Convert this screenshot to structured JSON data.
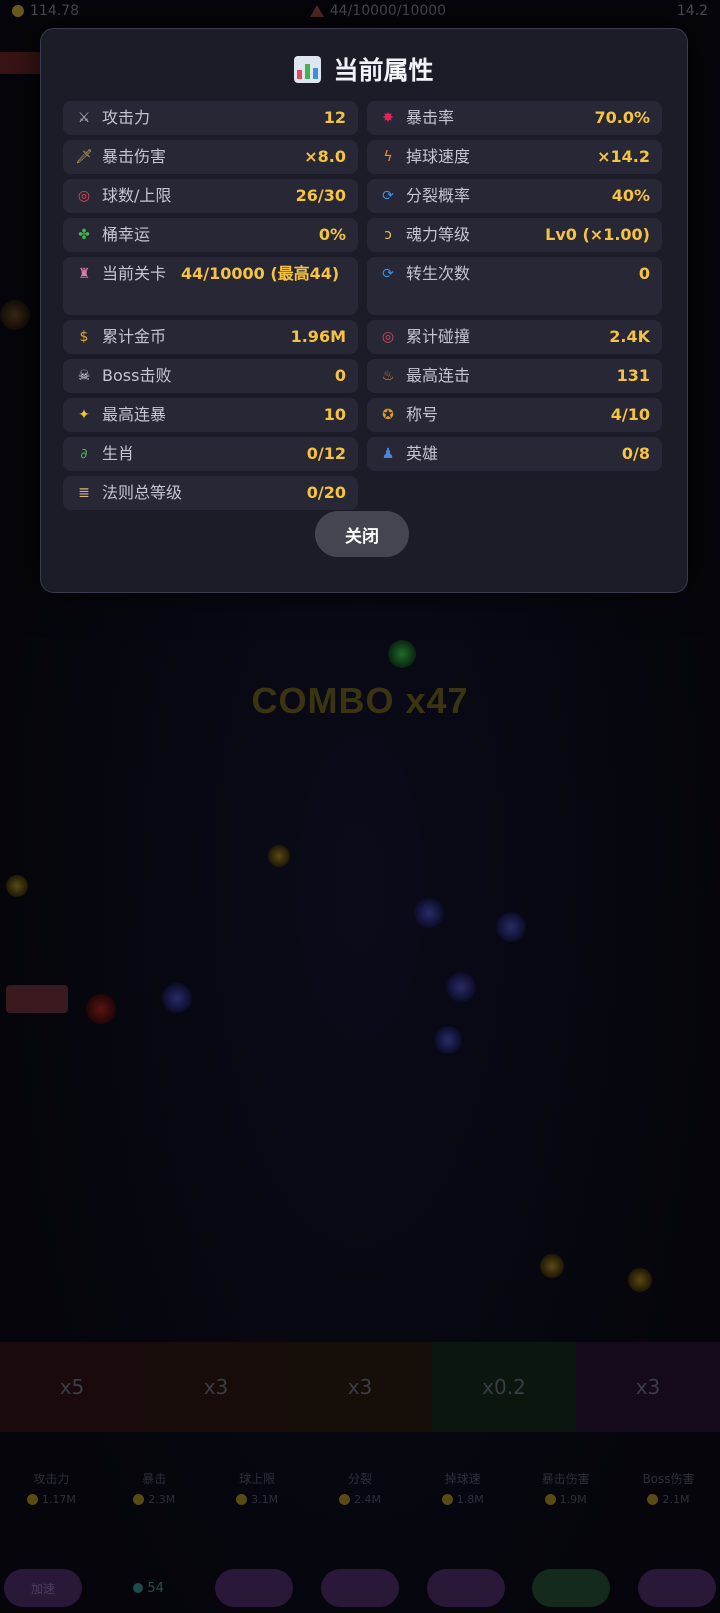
{
  "background": {
    "topbar": {
      "coins": "114.78",
      "level": "44/10000/10000",
      "right": "14.2"
    },
    "combo_text": "COMBO x47",
    "multipliers": [
      "x5",
      "x3",
      "x3",
      "x0.2",
      "x3"
    ],
    "upgrades": [
      {
        "name": "攻击力",
        "price": "1.17M"
      },
      {
        "name": "暴击",
        "price": "2.3M"
      },
      {
        "name": "球上限",
        "price": "3.1M"
      },
      {
        "name": "分裂",
        "price": "2.4M"
      },
      {
        "name": "掉球速",
        "price": "1.8M"
      },
      {
        "name": "暴击伤害",
        "price": "1.9M"
      },
      {
        "name": "Boss伤害",
        "price": "2.1M"
      }
    ],
    "nav": {
      "left": "加速",
      "count": "54"
    }
  },
  "modal": {
    "title": "当前属性",
    "close_label": "关闭",
    "stats": [
      {
        "icon": "crossed-swords-icon",
        "glyph": "⚔",
        "color": "#b9b9c8",
        "label": "攻击力",
        "value": "12"
      },
      {
        "icon": "explosion-icon",
        "glyph": "✸",
        "color": "#e0245e",
        "label": "暴击率",
        "value": "70.0%"
      },
      {
        "icon": "dagger-icon",
        "glyph": "🗡",
        "color": "#c9a24a",
        "label": "暴击伤害",
        "value": "×8.0"
      },
      {
        "icon": "lightning-icon",
        "glyph": "ϟ",
        "color": "#ff8a2a",
        "label": "掉球速度",
        "value": "×14.2"
      },
      {
        "icon": "target-icon",
        "glyph": "◎",
        "color": "#e04a5a",
        "label": "球数/上限",
        "value": "26/30"
      },
      {
        "icon": "cycle-icon",
        "glyph": "⟳",
        "color": "#3d8fe0",
        "label": "分裂概率",
        "value": "40%"
      },
      {
        "icon": "four-leaf-clover-icon",
        "glyph": "✤",
        "color": "#3fb54a",
        "label": "桶幸运",
        "value": "0%"
      },
      {
        "icon": "dizzy-swirl-icon",
        "glyph": "ↄ",
        "color": "#e8c23a",
        "label": "魂力等级",
        "value": "Lv0 (×1.00)"
      },
      {
        "icon": "castle-icon",
        "glyph": "♜",
        "color": "#d97aa8",
        "label": "当前关卡",
        "value": "44/10000 (最高44)"
      },
      {
        "icon": "cycle-icon",
        "glyph": "⟳",
        "color": "#3d8fe0",
        "label": "转生次数",
        "value": "0"
      },
      {
        "icon": "money-bag-icon",
        "glyph": "$",
        "color": "#d9a73a",
        "label": "累计金币",
        "value": "1.96M"
      },
      {
        "icon": "target-icon",
        "glyph": "◎",
        "color": "#e04a5a",
        "label": "累计碰撞",
        "value": "2.4K"
      },
      {
        "icon": "skull-icon",
        "glyph": "☠",
        "color": "#e6e6ee",
        "label": "Boss击败",
        "value": "0"
      },
      {
        "icon": "fire-icon",
        "glyph": "♨",
        "color": "#ff7a1a",
        "label": "最高连击",
        "value": "131"
      },
      {
        "icon": "sparkles-icon",
        "glyph": "✦",
        "color": "#f3c433",
        "label": "最高连暴",
        "value": "10"
      },
      {
        "icon": "medal-icon",
        "glyph": "✪",
        "color": "#e09a2a",
        "label": "称号",
        "value": "4/10"
      },
      {
        "icon": "dragon-icon",
        "glyph": "∂",
        "color": "#4fae5a",
        "label": "生肖",
        "value": "0/12"
      },
      {
        "icon": "person-icon",
        "glyph": "♟",
        "color": "#4a86d8",
        "label": "英雄",
        "value": "0/8"
      },
      {
        "icon": "scroll-icon",
        "glyph": "≣",
        "color": "#d8b27a",
        "label": "法则总等级",
        "value": "0/20"
      }
    ]
  }
}
